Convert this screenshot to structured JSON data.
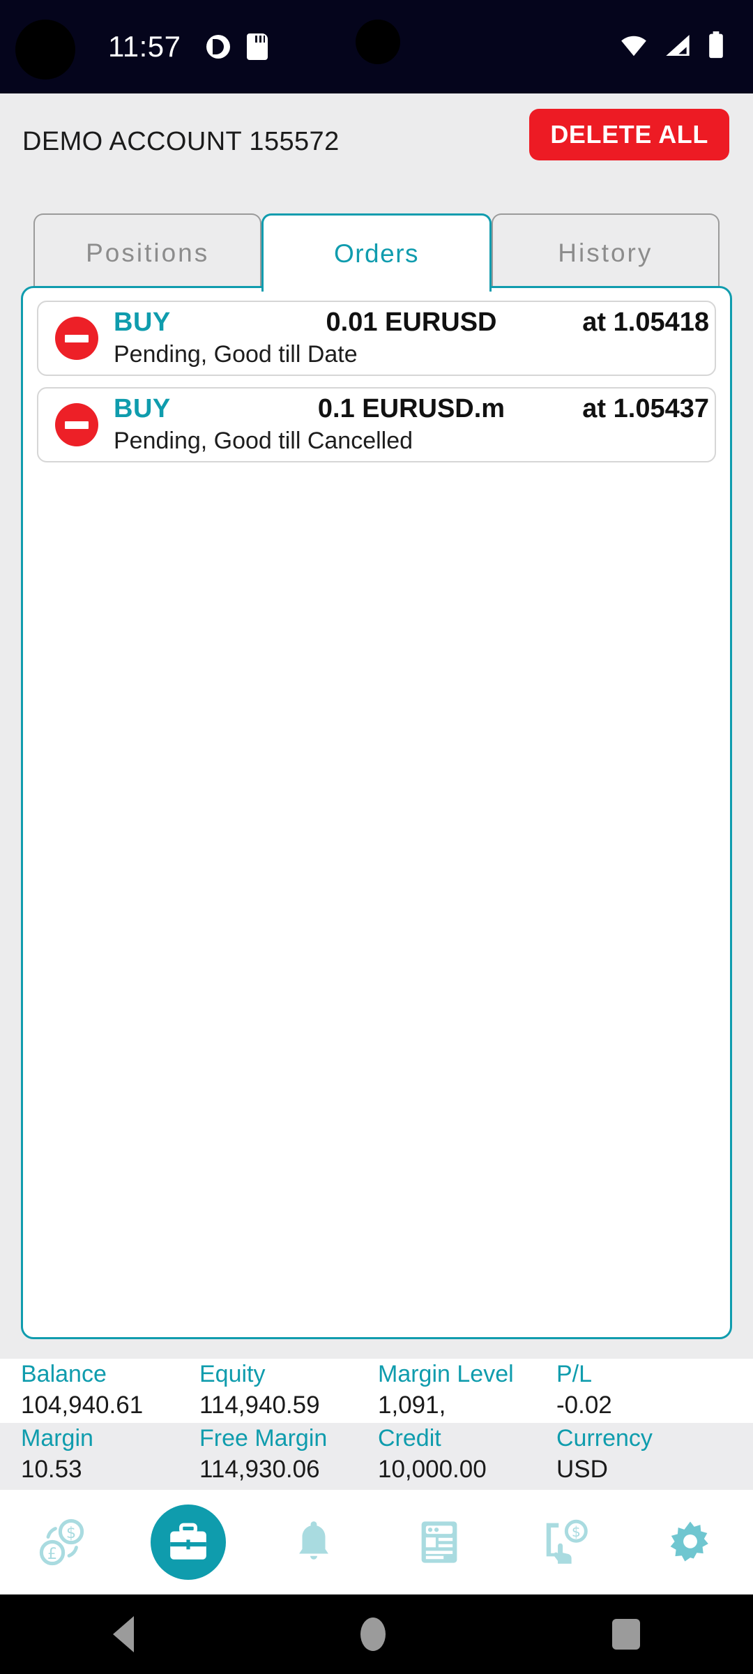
{
  "statusbar": {
    "time": "11:57",
    "icons_left": [
      "dnd-icon",
      "sd-card-icon"
    ],
    "icons_right": [
      "wifi-icon",
      "cellular-signal-icon",
      "battery-icon"
    ]
  },
  "header": {
    "account_title": "DEMO ACCOUNT 155572",
    "delete_all_label": "DELETE ALL"
  },
  "tabs": [
    {
      "label": "Positions",
      "active": false
    },
    {
      "label": "Orders",
      "active": true
    },
    {
      "label": "History",
      "active": false
    }
  ],
  "orders": [
    {
      "side": "BUY",
      "volume_symbol": "0.01 EURUSD",
      "price": "at 1.05418",
      "status": "Pending, Good till Date",
      "delete_icon": "remove-circle-icon"
    },
    {
      "side": "BUY",
      "volume_symbol": "0.1 EURUSD.m",
      "price": "at 1.05437",
      "status": "Pending, Good till Cancelled",
      "delete_icon": "remove-circle-icon"
    }
  ],
  "summary": {
    "row1": [
      {
        "label": "Balance",
        "value": "104,940.61"
      },
      {
        "label": "Equity",
        "value": "114,940.59"
      },
      {
        "label": "Margin Level",
        "value": "1,091,"
      },
      {
        "label": "P/L",
        "value": "-0.02"
      }
    ],
    "row2": [
      {
        "label": "Margin",
        "value": "10.53"
      },
      {
        "label": "Free Margin",
        "value": "114,930.06"
      },
      {
        "label": "Credit",
        "value": "10,000.00"
      },
      {
        "label": "Currency",
        "value": "USD"
      }
    ]
  },
  "bottomnav": [
    {
      "icon": "quotes-exchange-icon",
      "active": false
    },
    {
      "icon": "briefcase-trade-icon",
      "active": true
    },
    {
      "icon": "bell-alerts-icon",
      "active": false
    },
    {
      "icon": "news-article-icon",
      "active": false
    },
    {
      "icon": "tap-trade-icon",
      "active": false
    },
    {
      "icon": "gear-settings-icon",
      "active": false
    }
  ],
  "androidnav": [
    {
      "icon": "back-triangle-icon"
    },
    {
      "icon": "home-circle-icon"
    },
    {
      "icon": "recents-square-icon"
    }
  ],
  "colors": {
    "accent_teal": "#0f9cad",
    "danger_red": "#ed1b24",
    "background": "#ececed",
    "status_bar": "#05051c"
  }
}
